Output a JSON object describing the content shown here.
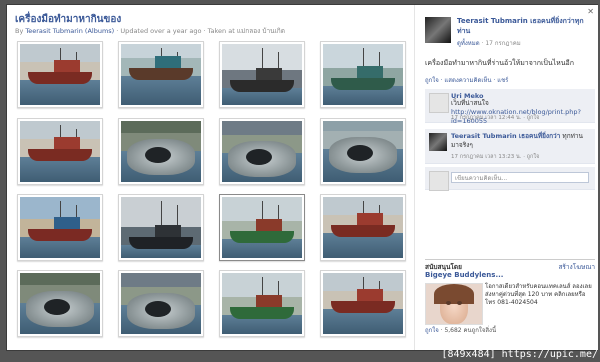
{
  "album": {
    "title": "เครื่องมือทำมาหากินของ",
    "by_label": "By",
    "author_link": "Teerasit Tubmarin (Albums)",
    "meta_rest": "· Updated over a year ago · Taken at แม่กลอง บ้านเกิด"
  },
  "thumbnails": [
    {
      "scene": "boat-red"
    },
    {
      "scene": "boat-teal"
    },
    {
      "scene": "boat-far"
    },
    {
      "scene": "boat-teal2"
    },
    {
      "scene": "boat-red"
    },
    {
      "scene": "net"
    },
    {
      "scene": "crew"
    },
    {
      "scene": "catch"
    },
    {
      "scene": "boat-bright"
    },
    {
      "scene": "boat-dark"
    },
    {
      "scene": "boat-green"
    },
    {
      "scene": "boat-red"
    },
    {
      "scene": "net"
    },
    {
      "scene": "crew"
    },
    {
      "scene": "boat-green"
    },
    {
      "scene": "boat-red"
    }
  ],
  "selected_index": 10,
  "poster": {
    "name": "Teerasit Tubmarin เธอคนที่ยิ่งกว่าทุกท่าน",
    "date_link": "ดูทั้งหมด",
    "date_rest": " · 17 กรกฎาคม"
  },
  "caption": "เครื่องมือทำมาหากินที่ร่านอ้วให้มาจากเป็นไหนอีก",
  "actions": "ถูกใจ · แสดงความคิดเห็น · แชร์",
  "comments": [
    {
      "name": "Uri Meko",
      "text": "เว็บที่น่าสนใจ",
      "link": "http://www.oknation.net/blog/print.php?id=160055",
      "date": "17 กรกฎาคม เวลา 12:44 น. · ถูกใจ"
    },
    {
      "name": "Teerasit Tubmarin เธอคนที่ยิ่งกว่า",
      "text": "ทุกท่าน มาจริงๆ",
      "date": "17 กรกฎาคม เวลา 13:23 น. · ถูกใจ"
    }
  ],
  "comment_placeholder": "เขียนความคิดเห็น...",
  "ad": {
    "label": "สนับสนุนโดย",
    "create": "สร้างโฆษณา",
    "title": "Bigeye Buddylens...",
    "body": "โอกาสเดียวสำหรับคอนแทคเลนส์ ลองเลยส่งหาคู่ด่วนที่สุด 120 บาท คลิกเลยหรือโทร 081-4024504",
    "like_label": "ถูกใจ",
    "like_rest": " · 5,682 คนถูกใจสิ่งนี้"
  },
  "watermark": "[849x484] https://upic.me/",
  "colors": {
    "link": "#3b5998",
    "backdrop": "#555555",
    "comment_bg": "#edeff4"
  }
}
